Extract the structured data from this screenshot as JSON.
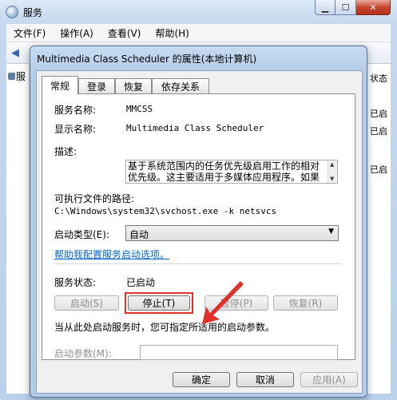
{
  "bg_window": {
    "title": "服务",
    "menu": [
      "文件(F)",
      "操作(A)",
      "查看(V)",
      "帮助(H)"
    ],
    "left_tab": "服",
    "right_fragments": [
      "状态",
      "已启",
      "已启",
      "已启"
    ]
  },
  "dialog": {
    "title": "Multimedia Class Scheduler 的属性(本地计算机)",
    "tabs": [
      "常规",
      "登录",
      "恢复",
      "依存关系"
    ],
    "service_name_label": "服务名称:",
    "service_name_value": "MMCSS",
    "display_name_label": "显示名称:",
    "display_name_value": "Multimedia Class Scheduler",
    "description_label": "描述:",
    "description_value": "基于系统范围内的任务优先级启用工作的相对优先级。这主要适用于多媒体应用程序。如果",
    "exe_path_label": "可执行文件的路径:",
    "exe_path_value": "C:\\Windows\\system32\\svchost.exe -k netsvcs",
    "startup_type_label": "启动类型(E):",
    "startup_type_value": "自动",
    "help_link": "帮助我配置服务启动选项。",
    "status_label": "服务状态:",
    "status_value": "已启动",
    "buttons": {
      "start": "启动(S)",
      "stop": "停止(T)",
      "pause": "暂停(P)",
      "resume": "恢复(R)"
    },
    "hint": "当从此处启动服务时，您可指定所适用的启动参数。",
    "start_params_label": "启动参数(M):",
    "start_params_value": "",
    "footer": {
      "ok": "确定",
      "cancel": "取消",
      "apply": "应用(A)"
    }
  },
  "colors": {
    "annotation": "#e0302a",
    "link": "#0066cc"
  }
}
